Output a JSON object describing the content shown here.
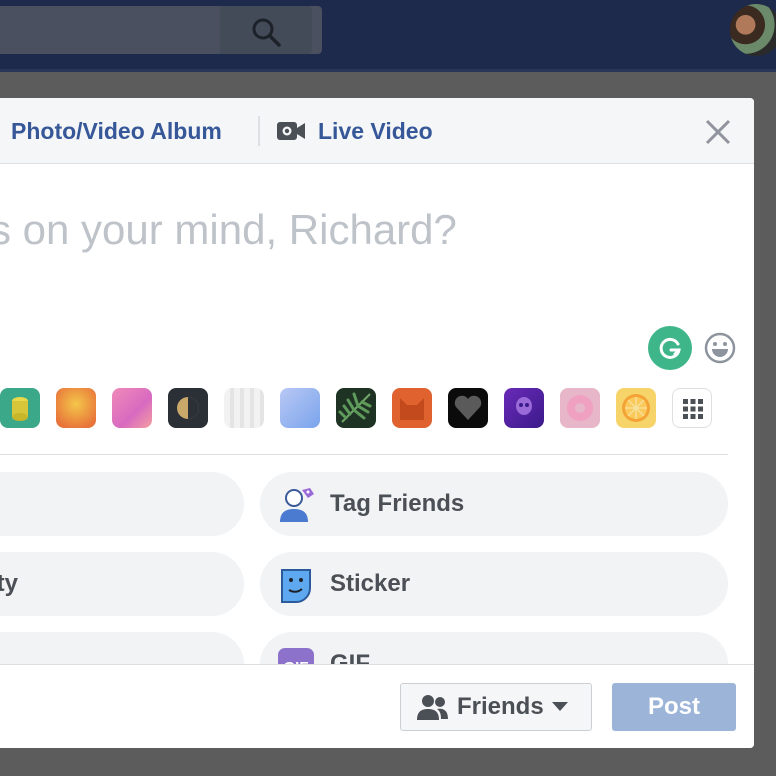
{
  "header": {
    "album_tab": "Photo/Video Album",
    "live_tab": "Live Video"
  },
  "composer": {
    "placeholder": "s on your mind, Richard?"
  },
  "actions": {
    "left": [
      "",
      "ity",
      ""
    ],
    "tag_friends": "Tag Friends",
    "sticker": "Sticker",
    "gif": "GIF",
    "gif_badge": "GIF"
  },
  "footer": {
    "audience": "Friends",
    "post": "Post"
  },
  "colors": {
    "topbar": "#1d2a4b",
    "link": "#365899",
    "post_disabled": "#9cb4d8",
    "grammarly": "#3fb58a"
  },
  "icons": [
    "search-icon",
    "video-camera-icon",
    "close-icon",
    "grammarly-icon",
    "smiley-icon",
    "grid-icon",
    "tag-friends-icon",
    "sticker-icon",
    "gif-icon",
    "friends-icon",
    "caret-down-icon"
  ]
}
